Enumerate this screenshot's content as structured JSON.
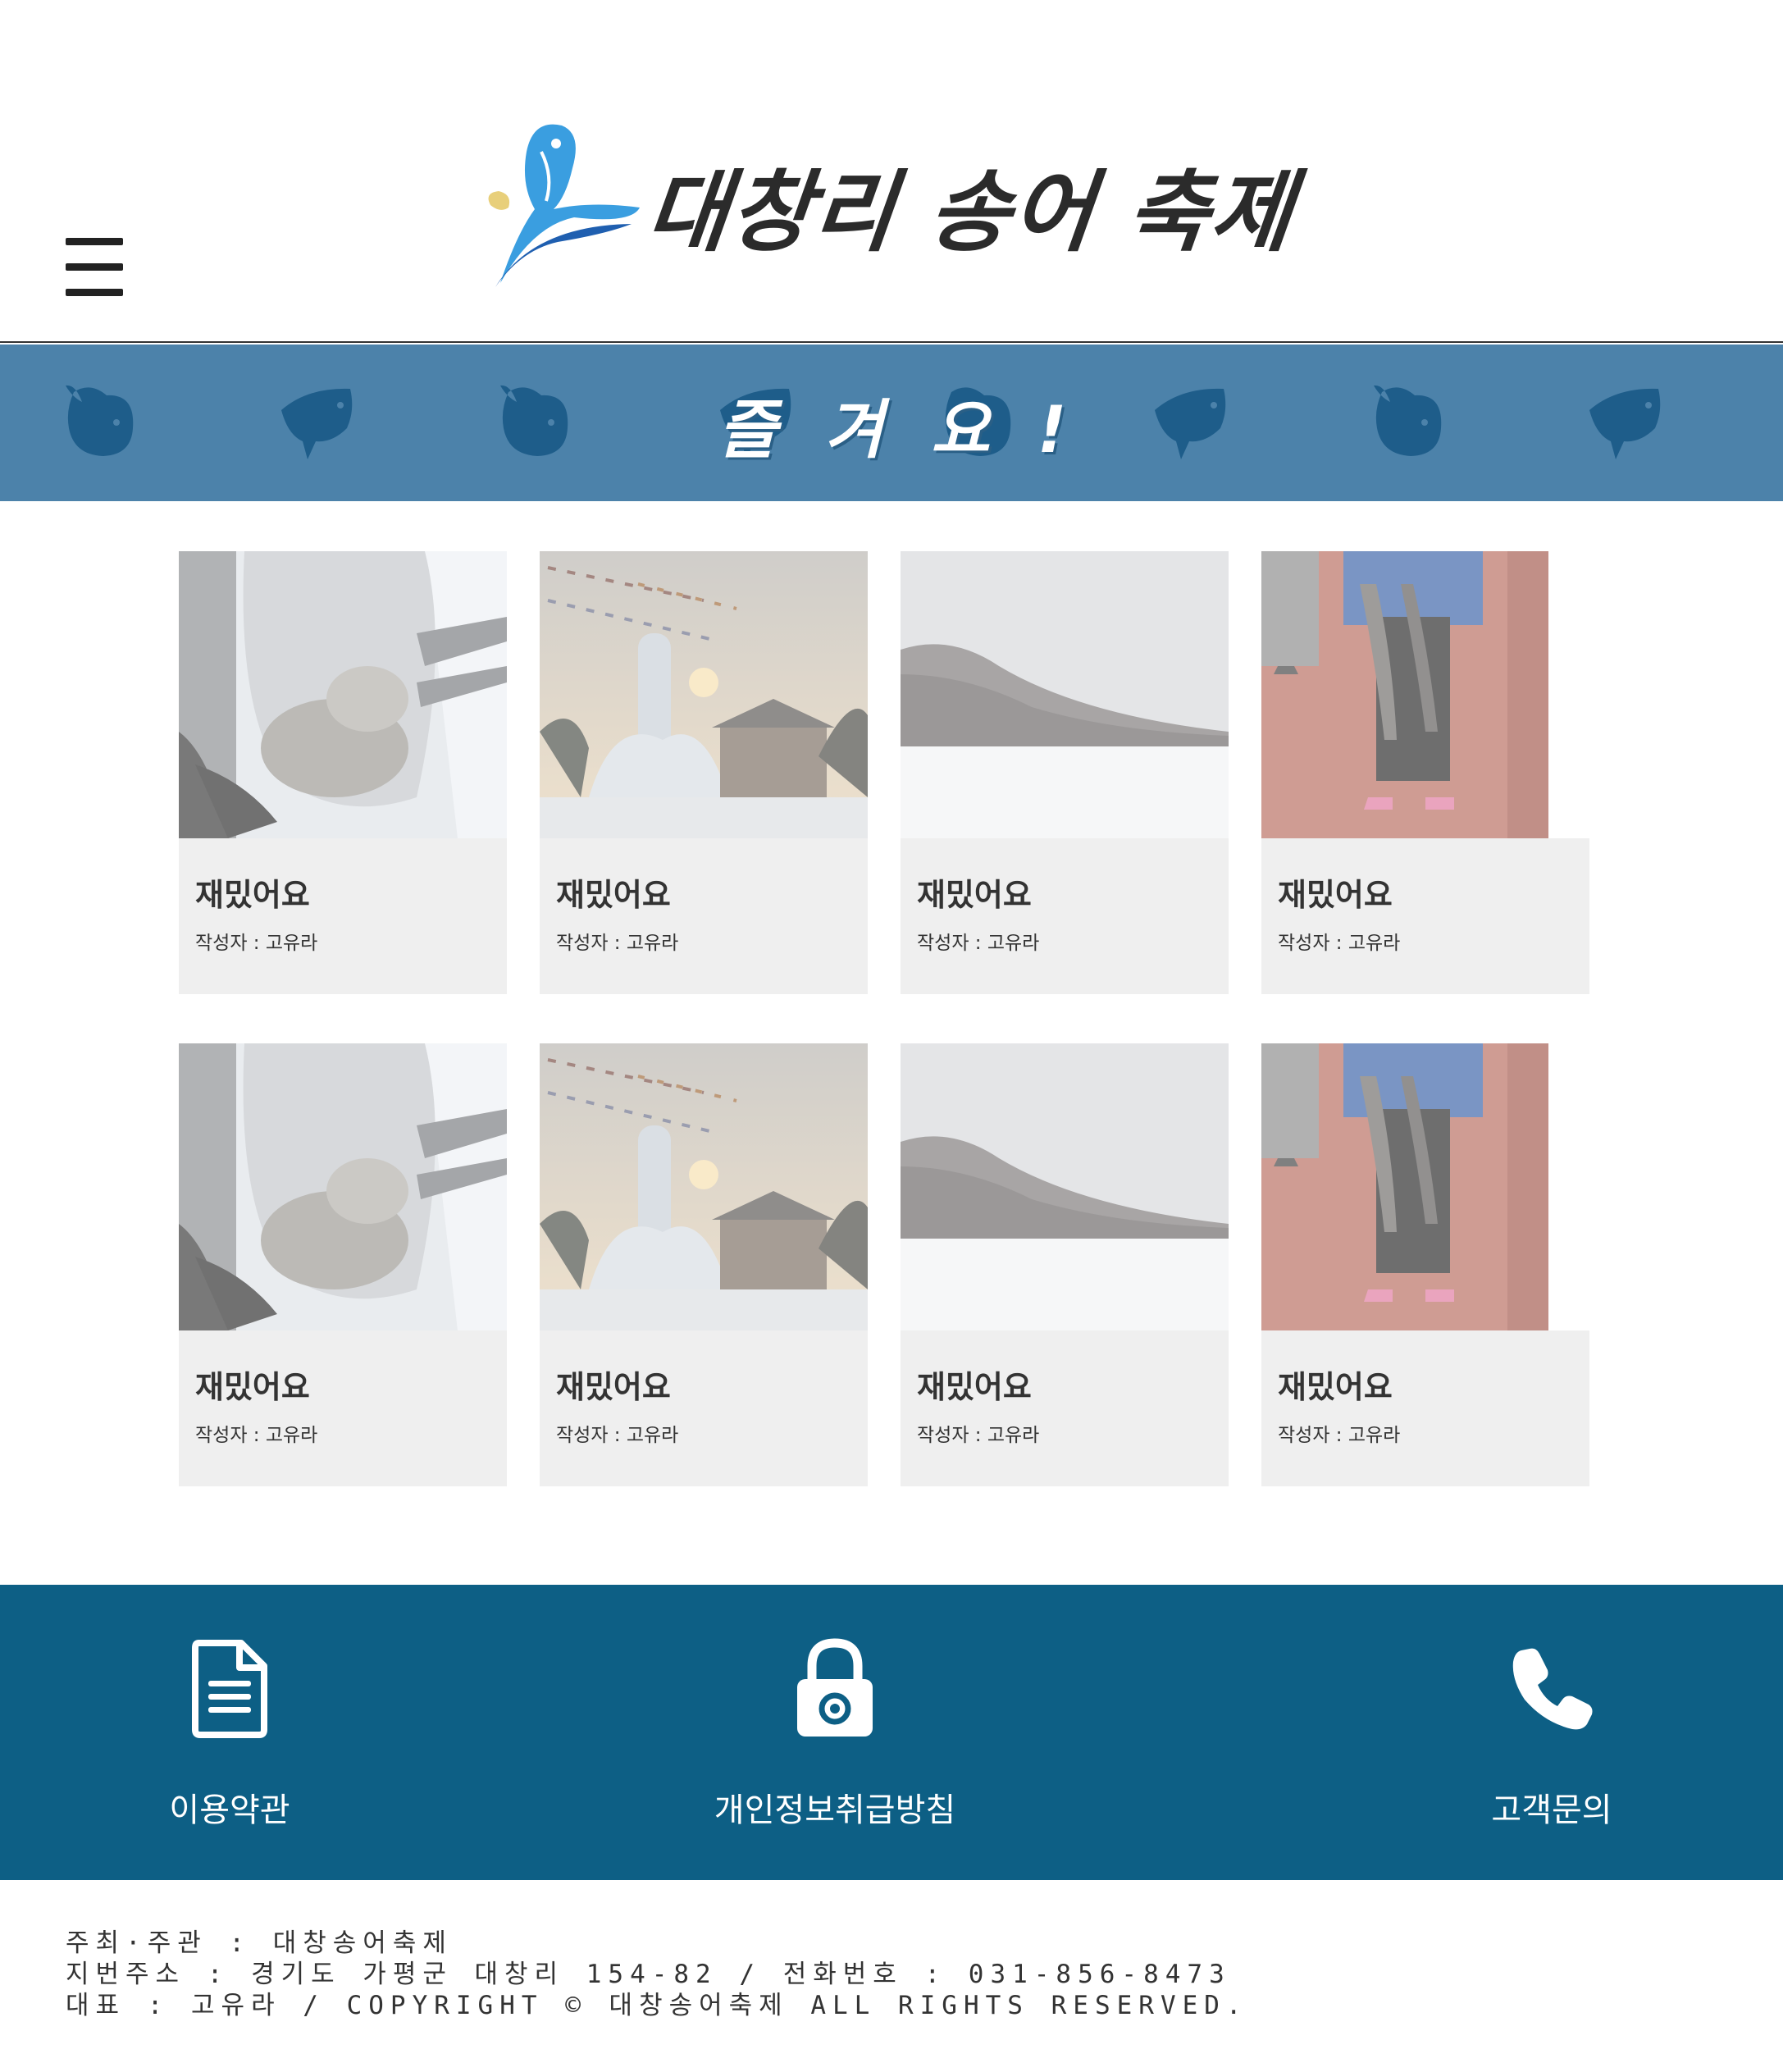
{
  "header": {
    "logo_text": "대창리 송어 축제",
    "menu_icon": "hamburger-menu-icon"
  },
  "banner": {
    "text": "즐겨요!",
    "background": "#4c82aa",
    "fish_color": "#1e5d8a"
  },
  "gallery": {
    "cards": [
      {
        "title": "재밌어요",
        "author": "작성자 : 고유라",
        "image": "bag-of-fish"
      },
      {
        "title": "재밌어요",
        "author": "작성자 : 고유라",
        "image": "ice-sculpture-sunset"
      },
      {
        "title": "재밌어요",
        "author": "작성자 : 고유라",
        "image": "frozen-lake"
      },
      {
        "title": "재밌어요",
        "author": "작성자 : 고유라",
        "image": "person-holding-fish"
      },
      {
        "title": "재밌어요",
        "author": "작성자 : 고유라",
        "image": "bag-of-fish"
      },
      {
        "title": "재밌어요",
        "author": "작성자 : 고유라",
        "image": "ice-sculpture-sunset"
      },
      {
        "title": "재밌어요",
        "author": "작성자 : 고유라",
        "image": "frozen-lake"
      },
      {
        "title": "재밌어요",
        "author": "작성자 : 고유라",
        "image": "person-holding-fish"
      }
    ]
  },
  "footer_nav": {
    "background": "#0d5f85",
    "items": [
      {
        "label": "이용약관",
        "icon": "document-icon"
      },
      {
        "label": "개인정보취급방침",
        "icon": "lock-icon"
      },
      {
        "label": "고객문의",
        "icon": "phone-icon"
      }
    ]
  },
  "footer_info": {
    "line1": "주최·주관 : 대창송어축제",
    "line2": "지번주소 : 경기도 가평군 대창리 154-82 / 전화번호 : 031-856-8473",
    "line3": "대표 : 고유라 / COPYRIGHT © 대창송어축제 ALL RIGHTS RESERVED."
  }
}
